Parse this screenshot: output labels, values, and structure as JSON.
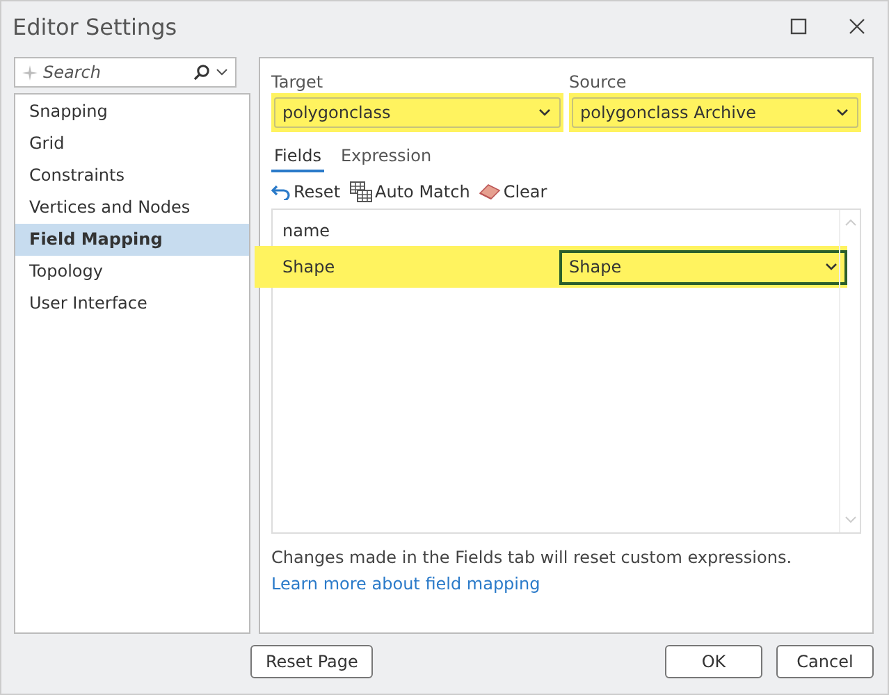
{
  "window": {
    "title": "Editor Settings"
  },
  "search": {
    "placeholder": "Search"
  },
  "sidebar": {
    "items": [
      {
        "label": "Snapping",
        "selected": false
      },
      {
        "label": "Grid",
        "selected": false
      },
      {
        "label": "Constraints",
        "selected": false
      },
      {
        "label": "Vertices and Nodes",
        "selected": false
      },
      {
        "label": "Field Mapping",
        "selected": true
      },
      {
        "label": "Topology",
        "selected": false
      },
      {
        "label": "User Interface",
        "selected": false
      }
    ]
  },
  "target": {
    "label": "Target",
    "value": "polygonclass",
    "highlighted": true
  },
  "source": {
    "label": "Source",
    "value": "polygonclass Archive",
    "highlighted": true
  },
  "tabs": [
    {
      "label": "Fields",
      "selected": true
    },
    {
      "label": "Expression",
      "selected": false
    }
  ],
  "toolbar": [
    {
      "kind": "reset",
      "label": "Reset"
    },
    {
      "kind": "automatch",
      "label": "Auto Match"
    },
    {
      "kind": "clear",
      "label": "Clear"
    }
  ],
  "table": {
    "columns": [
      "name"
    ],
    "rows": [
      {
        "name": "Shape",
        "value": "Shape",
        "highlighted": true
      }
    ]
  },
  "note": "Changes made in the Fields tab will reset custom expressions.",
  "link": "Learn more about field mapping",
  "buttons": {
    "reset": "Reset Page",
    "ok": "OK",
    "cancel": "Cancel"
  }
}
